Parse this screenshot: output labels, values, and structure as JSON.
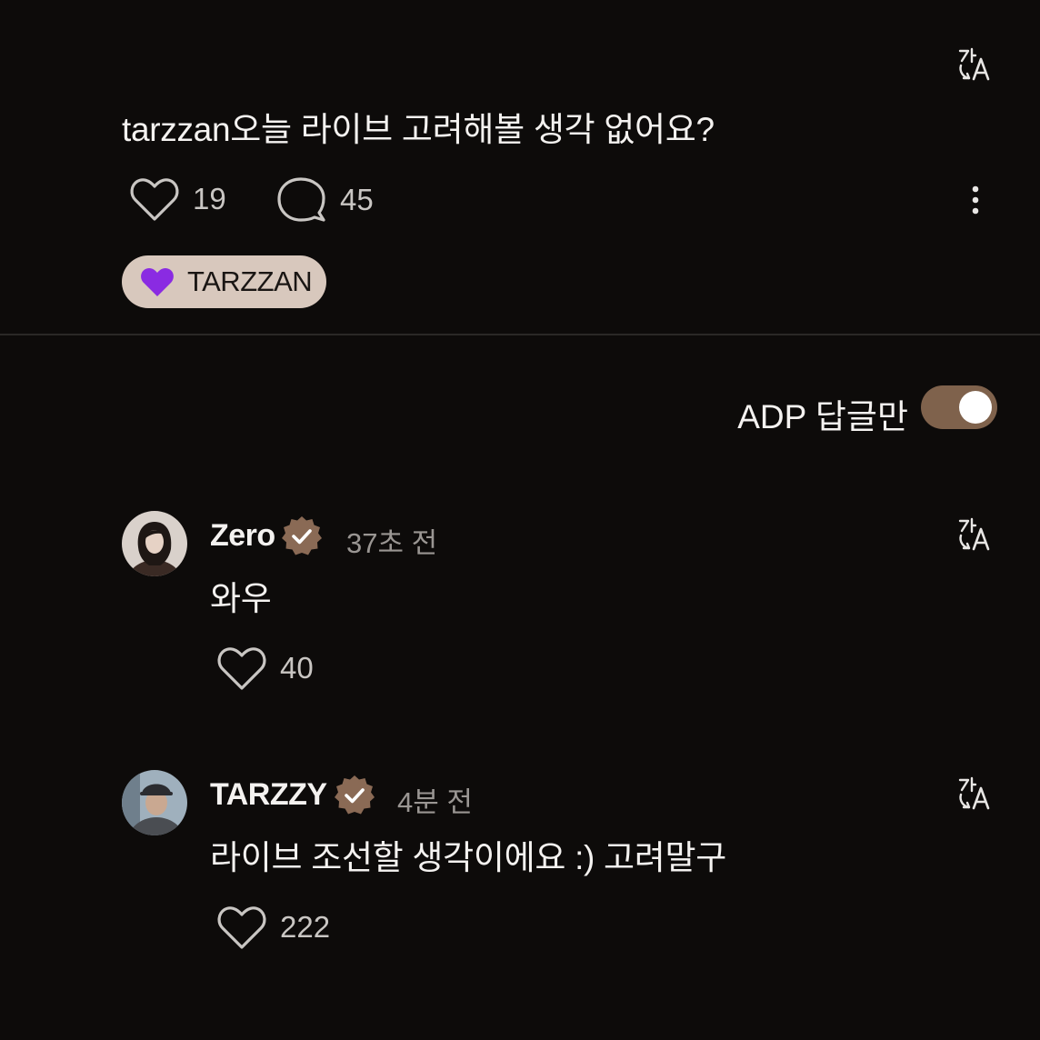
{
  "post": {
    "text": "tarzzan오늘 라이브 고려해볼 생각 없어요?",
    "like_count": "19",
    "comment_count": "45",
    "tag_chip": "TARZZAN"
  },
  "filter": {
    "label": "ADP 답글만",
    "toggle_on": true
  },
  "comments": [
    {
      "username": "Zero",
      "time": "37초 전",
      "text": "와우",
      "like_count": "40"
    },
    {
      "username": "TARZZY",
      "time": "4분 전",
      "text": "라이브 조선할 생각이에요 :) 고려말구",
      "like_count": "222"
    }
  ],
  "icons": {
    "translate": "translate-icon",
    "like": "heart-icon",
    "comment": "comment-bubble-icon",
    "more": "more-vertical-icon",
    "verified": "verified-badge-icon",
    "chip_heart": "purple-heart-icon"
  },
  "colors": {
    "background": "#0d0b0a",
    "chip_background": "#d8c8bd",
    "toggle_on": "#7f624c",
    "verified_badge": "#8a6a55",
    "chip_heart": "#8a2be2",
    "muted_text": "#9a9693"
  }
}
